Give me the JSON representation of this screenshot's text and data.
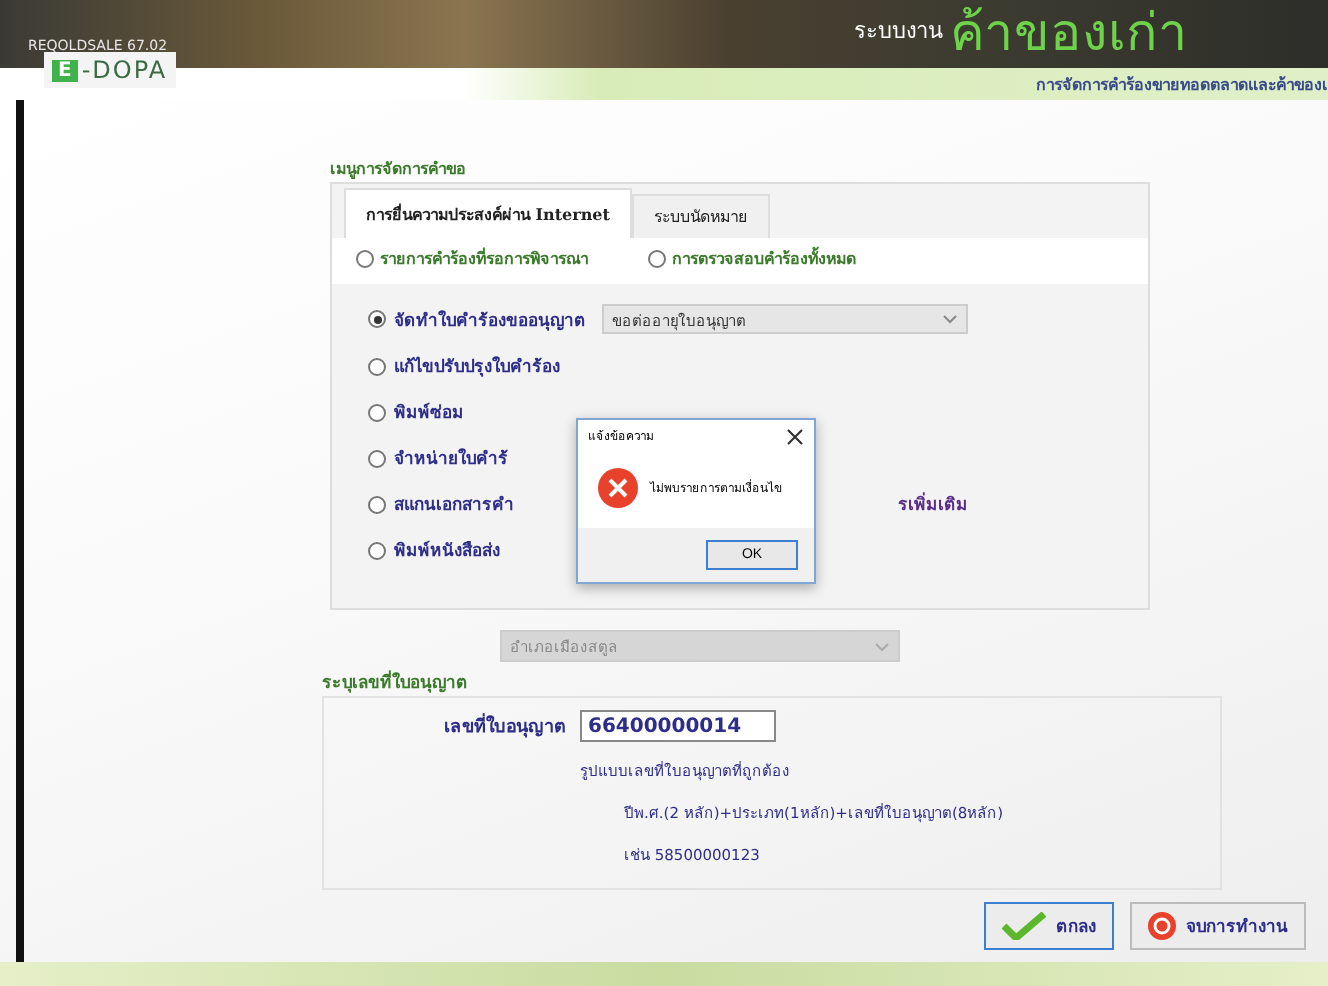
{
  "header": {
    "version": "REQOLDSALE 67.02",
    "logo_mark": "E",
    "logo_text": "-DOPA",
    "system_label": "ระบบงาน",
    "system_name": "ค้าของเก่า",
    "subtitle": "การจัดการคำร้องขายทอดตลาดและค้าของเ"
  },
  "menu": {
    "title": "เมนูการจัดการคำขอ",
    "tabs": [
      {
        "label": "การยื่นความประสงค์ผ่าน Internet",
        "selected": true
      },
      {
        "label": "ระบบนัดหมาย",
        "selected": false
      }
    ],
    "tab_options": [
      {
        "label": "รายการคำร้องที่รอการพิจารณา",
        "selected": false
      },
      {
        "label": "การตรวจสอบคำร้องทั้งหมด",
        "selected": false
      }
    ],
    "options": [
      {
        "label": "จัดทำใบคำร้องขออนุญาต",
        "selected": true,
        "dropdown": "ขอต่ออายุใบอนุญาต"
      },
      {
        "label": "แก้ไขปรับปรุงใบคำร้อง",
        "selected": false
      },
      {
        "label": "พิมพ์ซ่อม",
        "selected": false
      },
      {
        "label": "จำหน่ายใบคำร้",
        "selected": false
      },
      {
        "label": "สแกนเอกสารคำ",
        "selected": false,
        "tail": "รเพิ่มเติม"
      },
      {
        "label": "พิมพ์หนังสือส่ง",
        "selected": false
      }
    ]
  },
  "district_dropdown": {
    "value": "อำเภอเมืองสตูล",
    "disabled": true
  },
  "license": {
    "title": "ระบุเลขที่ใบอนุญาต",
    "label": "เลขที่ใบอนุญาต",
    "value": "66400000014",
    "format_title": "รูปแบบเลขที่ใบอนุญาตที่ถูกต้อง",
    "format": "ปีพ.ศ.(2 หลัก)+ประเภท(1หลัก)+เลขที่ใบอนุญาต(8หลัก)",
    "example": "เช่น 58500000123"
  },
  "buttons": [
    {
      "label": "ตกลง",
      "kind": "ok"
    },
    {
      "label": "จบการทำงาน",
      "kind": "exit"
    }
  ],
  "dialog": {
    "title": "แจ้งข้อความ",
    "message": "ไม่พบรายการตามเงื่อนไข",
    "button": "OK"
  }
}
